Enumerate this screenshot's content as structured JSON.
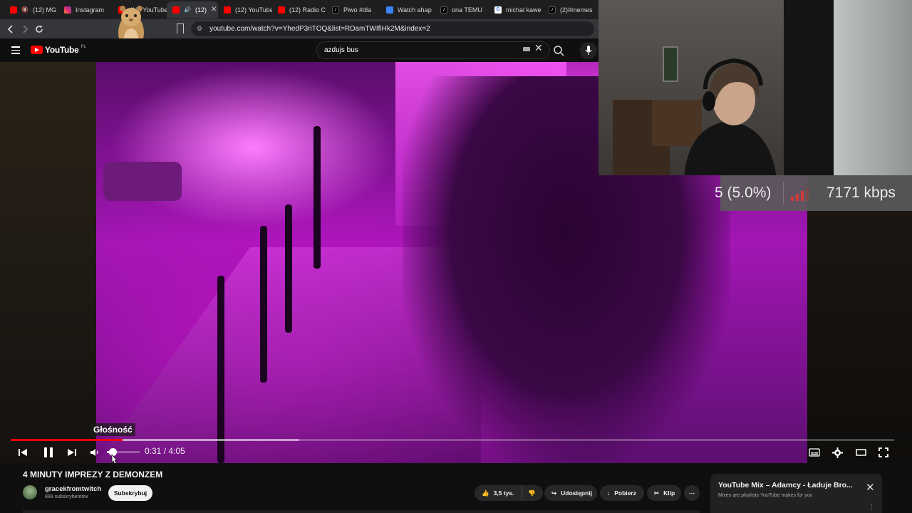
{
  "browser": {
    "tabs": [
      {
        "label": "(12) MG",
        "icon": "youtube-icon",
        "muted": true
      },
      {
        "label": "Instagram",
        "icon": "instagram-icon"
      },
      {
        "label": "(12) YouTube",
        "icon": "youtube-icon"
      },
      {
        "label": "(12)",
        "icon": "youtube-icon",
        "active": true,
        "audio": true
      },
      {
        "label": "(12) YouTube",
        "icon": "youtube-icon"
      },
      {
        "label": "(12) Radio C",
        "icon": "youtube-icon"
      },
      {
        "label": "Piwo #dla",
        "icon": "tiktok-icon"
      },
      {
        "label": "Watch ahap",
        "icon": "web-icon"
      },
      {
        "label": "ona TEMU",
        "icon": "tiktok-icon"
      },
      {
        "label": "michal kawe",
        "icon": "google-icon"
      },
      {
        "label": "(2)#memes",
        "icon": "tiktok-icon"
      }
    ],
    "url": "youtube.com/watch?v=YhedP3riTOQ&list=RDamTWIfiHk2M&index=2"
  },
  "youtube": {
    "logo_text": "YouTube",
    "region": "PL",
    "search_value": "azdujs bus"
  },
  "player": {
    "tooltip": "Głośność",
    "current_time": "0:31",
    "duration": "4:05",
    "time_display": "0:31 / 4:05",
    "played_fraction": 0.127,
    "buffered_fraction": 0.327,
    "volume_fraction": 0.2
  },
  "stats_overlay": {
    "drop_pct": "5 (5.0%)",
    "bitrate": "7171 kbps"
  },
  "video_info": {
    "title": "4 MINUTY IMPREZY Z DEMONZEM",
    "channel_name": "gracekfromtwitch",
    "subscribers": "899 subskrybentów",
    "subscribe_label": "Subskrybuj",
    "likes": "3,5 tys.",
    "share_label": "Udostępnij",
    "download_label": "Pobierz",
    "clip_label": "Klip"
  },
  "mix_panel": {
    "title": "YouTube Mix – Adamcy - Ładuje Bro...",
    "subtitle": "Mixes are playlists YouTube makes for you"
  },
  "colors": {
    "accent_red": "#ff0000",
    "background": "#0f0f0f"
  }
}
